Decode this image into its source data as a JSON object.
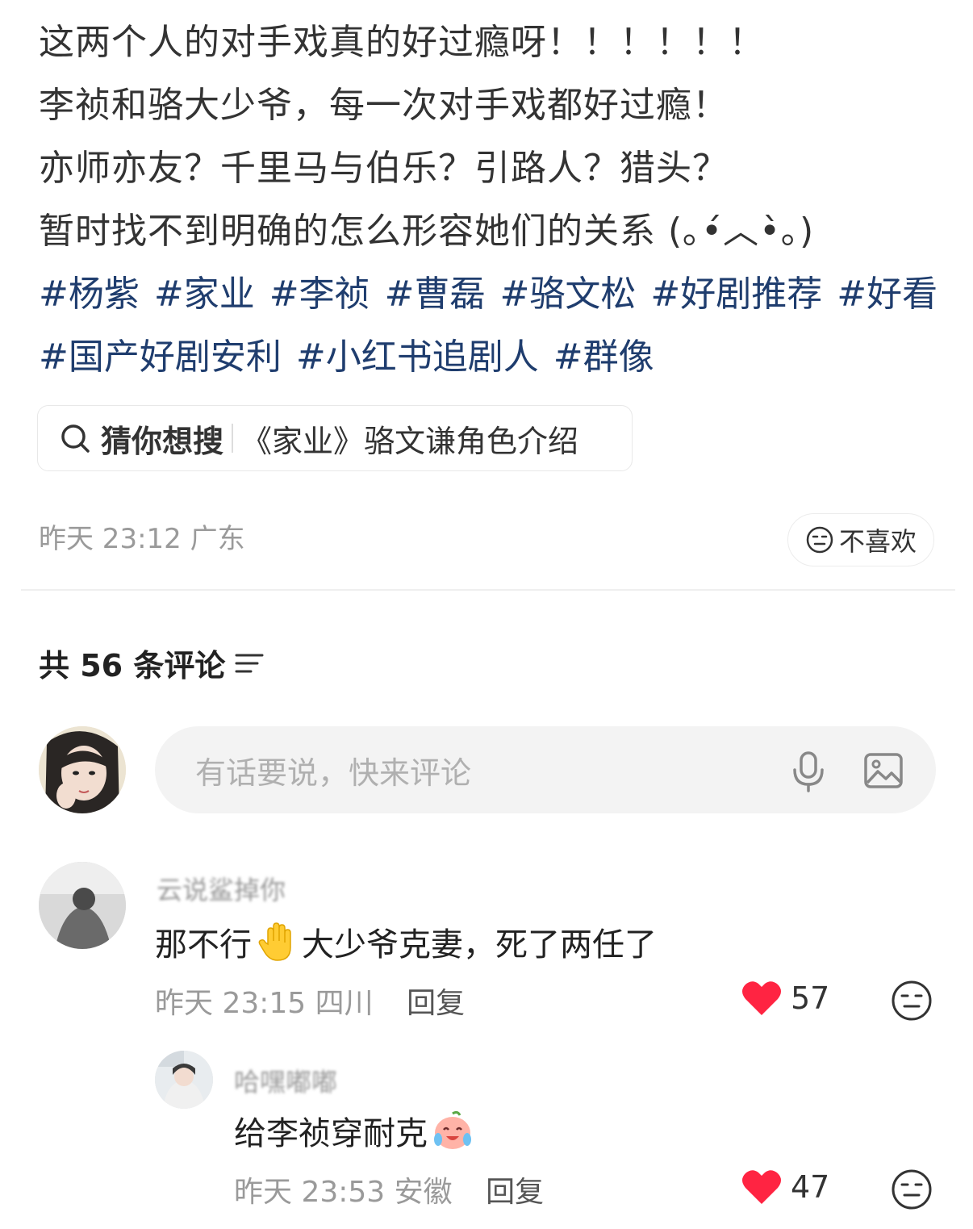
{
  "post": {
    "lines": [
      "这两个人的对手戏真的好过瘾呀！！！！！！",
      "李祯和骆大少爷，每一次对手戏都好过瘾！",
      "亦师亦友？千里马与伯乐？引路人？猎头？",
      "暂时找不到明确的怎么形容她们的关系 (｡•́︿•̀｡)"
    ],
    "tags_row1": [
      "#杨紫",
      "#家业",
      "#李祯",
      "#曹磊",
      "#骆文松",
      "#好剧推荐",
      "#好看"
    ],
    "tags_row2": [
      "#国产好剧安利",
      "#小红书追剧人",
      "#群像"
    ],
    "search_suggest": {
      "label": "猜你想搜",
      "query": "《家业》骆文谦角色介绍",
      "icon": "search-icon"
    },
    "meta": "昨天 23:12 广东",
    "dislike_label": "不喜欢"
  },
  "comments_header": {
    "text": "共 56 条评论",
    "icon": "sort-icon"
  },
  "input": {
    "placeholder": "有话要说，快来评论",
    "icons": [
      "microphone-icon",
      "image-icon"
    ]
  },
  "comments": [
    {
      "username": "云说鲨掉你",
      "text_before": "那不行",
      "emoji": "raised-hand-emoji",
      "text_after": "大少爷克妻，死了两任了",
      "time": "昨天 23:15",
      "location": "四川",
      "reply_label": "回复",
      "likes": "57",
      "liked": true
    },
    {
      "username": "哈嘿嘟嘟",
      "text_before": "给李祯穿耐克",
      "emoji": "crying-laughing-emoji",
      "text_after": "",
      "time": "昨天 23:53",
      "location": "安徽",
      "reply_label": "回复",
      "likes": "47",
      "liked": true
    }
  ],
  "colors": {
    "tag": "#1f3d6e",
    "like": "#ff2442",
    "muted": "#9a9a9a"
  }
}
